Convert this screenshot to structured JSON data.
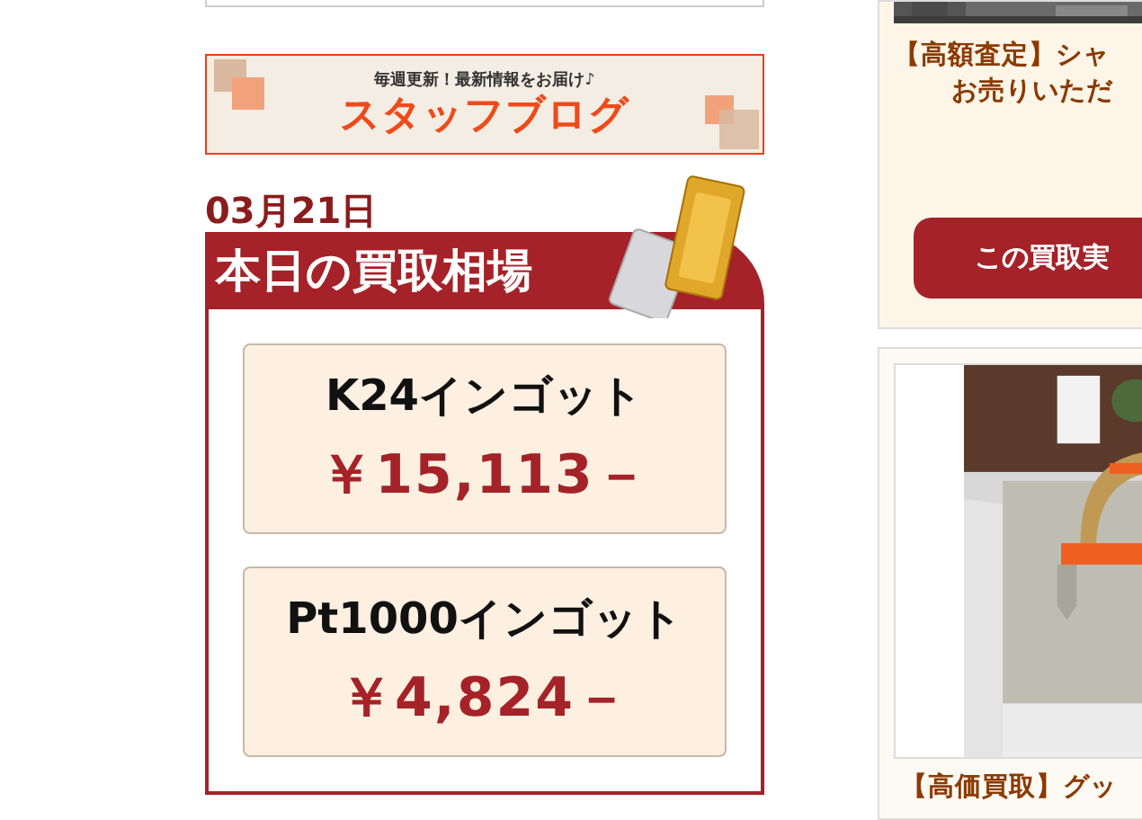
{
  "sidebar": {
    "blog_banner": {
      "tagline": "毎週更新！最新情報をお届け♪",
      "title": "スタッフブログ"
    },
    "date": "03月21日",
    "prices_heading": "本日の買取相場",
    "prices": [
      {
        "name": "K24インゴット",
        "price": "￥15,113－"
      },
      {
        "name": "Pt1000インゴット",
        "price": "￥4,824－"
      }
    ]
  },
  "cases": [
    {
      "title_lines": [
        "【高額査定】シャ",
        "お売りいただ"
      ],
      "button": "この買取実"
    },
    {
      "title_lines": [
        "【高価買取】グッ"
      ]
    }
  ]
}
